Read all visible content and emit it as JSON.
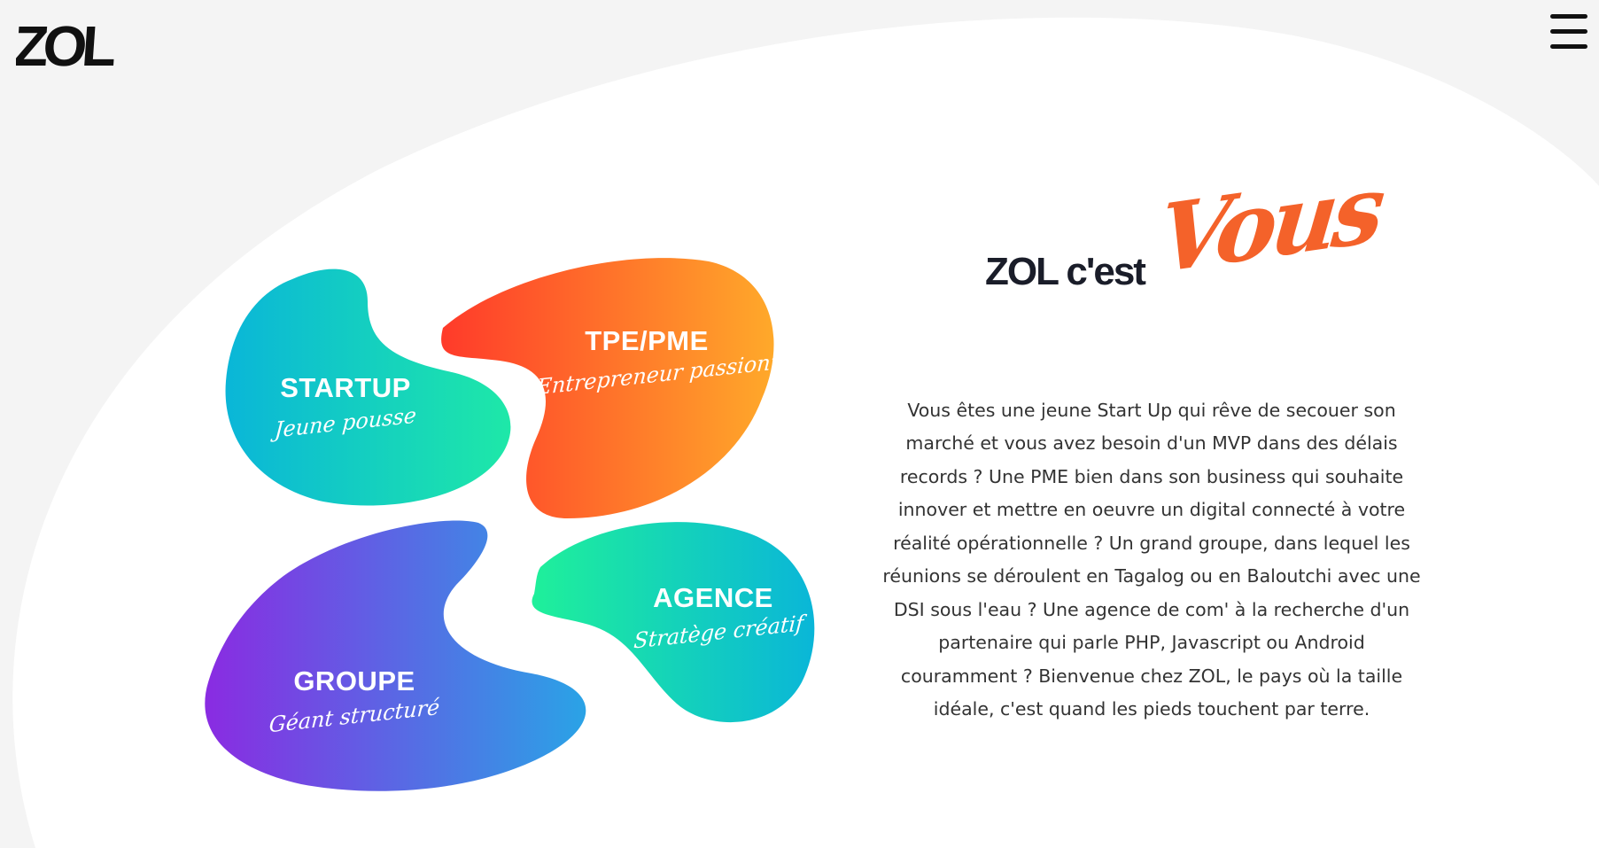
{
  "brand": {
    "logo_text": "ZOL"
  },
  "header": {
    "menu_icon": "hamburger-menu-icon"
  },
  "cards": [
    {
      "title": "STARTUP",
      "subtitle": "Jeune pousse",
      "gradient": [
        "#0ab6d8",
        "#1ee8a8"
      ]
    },
    {
      "title": "TPE/PME",
      "subtitle": "Entrepreneur passionné",
      "gradient": [
        "#ff3a2a",
        "#ffa92a"
      ]
    },
    {
      "title": "GROUPE",
      "subtitle": "Géant structuré",
      "gradient": [
        "#8a2be2",
        "#2aa3e6"
      ]
    },
    {
      "title": "AGENCE",
      "subtitle": "Stratège créatif",
      "gradient": [
        "#1ff09a",
        "#0ab6d8"
      ]
    }
  ],
  "headline": {
    "text": "ZOL c'est",
    "accent": "Vous",
    "accent_color": "#f4622a"
  },
  "intro": {
    "paragraph": "Vous êtes une jeune Start Up qui rêve de secouer son marché et vous avez besoin d'un MVP dans des délais records ? Une PME bien dans son business qui souhaite innover et mettre en oeuvre un digital connecté à votre réalité opérationnelle ? Un grand groupe, dans lequel les réunions se déroulent en Tagalog ou en Baloutchi avec une DSI sous l'eau ? Une agence de com' à la recherche d'un partenaire qui parle PHP, Javascript ou Android couramment ? Bienvenue chez ZOL, le pays où la taille idéale, c'est quand les pieds touchent par terre."
  },
  "colors": {
    "page_bg": "#f4f4f4",
    "panel_bg": "#ffffff",
    "text": "#333333",
    "headline": "#1a1d29"
  }
}
